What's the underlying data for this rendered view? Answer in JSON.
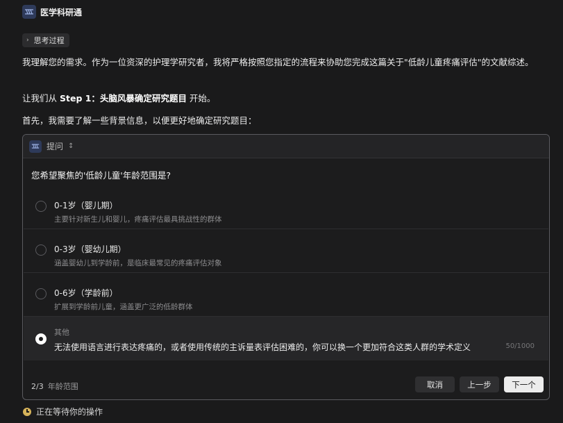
{
  "app": {
    "title": "医学科研通"
  },
  "thinking": {
    "label": "思考过程"
  },
  "message": {
    "p1": "我理解您的需求。作为一位资深的护理学研究者，我将严格按照您指定的流程来协助您完成这篇关于\"低龄儿童疼痛评估\"的文献综述。",
    "p2_prefix": "让我们从 ",
    "p2_bold": "Step 1：头脑风暴确定研究题目",
    "p2_suffix": " 开始。",
    "p3": "首先，我需要了解一些背景信息，以便更好地确定研究题目："
  },
  "panel": {
    "label": "提问",
    "question": "您希望聚焦的'低龄儿童'年龄范围是?",
    "options": [
      {
        "title": "0-1岁（婴儿期）",
        "desc": "主要针对新生儿和婴儿，疼痛评估最具挑战性的群体"
      },
      {
        "title": "0-3岁（婴幼儿期）",
        "desc": "涵盖婴幼儿到学龄前，是临床最常见的疼痛评估对象"
      },
      {
        "title": "0-6岁（学龄前）",
        "desc": "扩展到学龄前儿童，涵盖更广泛的低龄群体"
      }
    ],
    "other": {
      "title": "其他",
      "value": "无法使用语言进行表达疼痛的，或者使用传统的主诉量表评估困难的，你可以换一个更加符合这类人群的学术定义",
      "counter": "50/1000"
    },
    "footer": {
      "step_num": "2/3",
      "step_label": "年龄范围",
      "cancel": "取消",
      "prev": "上一步",
      "next": "下一个"
    }
  },
  "status": {
    "text": "正在等待你的操作"
  },
  "colors": {
    "accent": "#d6b35a",
    "logo_bg": "#2e3a5a"
  }
}
